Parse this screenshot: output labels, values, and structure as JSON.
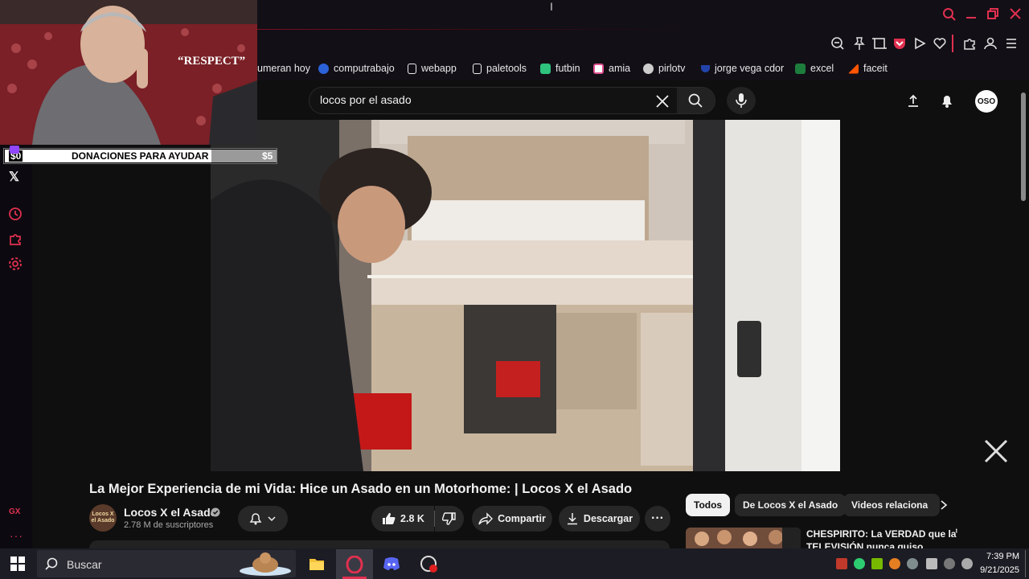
{
  "browser": {
    "bookmarks": [
      "umeran hoy",
      "computrabajo",
      "webapp",
      "paletools",
      "futbin",
      "amia",
      "pirlotv",
      "jorge vega cdor",
      "excel",
      "faceit"
    ],
    "bookmark_colors": [
      "#e8e8e8",
      "#2c62d8",
      "#f0f0f0",
      "#f0f0f0",
      "#2ec27e",
      "#e05090",
      "#cccccc",
      "#2244aa",
      "#1d7d3c",
      "#ff5500"
    ]
  },
  "overlay": {
    "respect": "“RESPECT”",
    "donation_left": "$0",
    "donation_label": "DONACIONES PARA AYUDAR",
    "donation_right": "$5"
  },
  "youtube": {
    "search_query": "locos por el asado",
    "avatar_label": "OSO",
    "video_title": "La Mejor Experiencia de mi Vida: Hice un Asado en un Motorhome: | Locos X el Asado",
    "channel_logo_text": "Locos X el Asado",
    "channel_name": "Locos X el Asado",
    "subscribers": "2.78 M de suscriptores",
    "likes": "2.8 K",
    "share_label": "Compartir",
    "download_label": "Descargar",
    "chips": [
      "Todos",
      "De Locos X el Asado",
      "Videos relaciona"
    ],
    "related_title_line1": "CHESPIRITO: La VERDAD que la",
    "related_title_line2": "TELEVISIÓN nunca quiso"
  },
  "sidebar_icons": [
    "x-icon",
    "clock-icon",
    "extensions-icon",
    "settings-icon",
    "gx-icon",
    "more-icon"
  ],
  "sidebar_gx": "GX",
  "taskbar": {
    "search_placeholder": "Buscar",
    "time": "7:39 PM",
    "date": "9/21/2025"
  },
  "colors": {
    "accent": "#e0304f",
    "background": "#0f0f0f",
    "chip_active_bg": "#f1f1f1"
  }
}
